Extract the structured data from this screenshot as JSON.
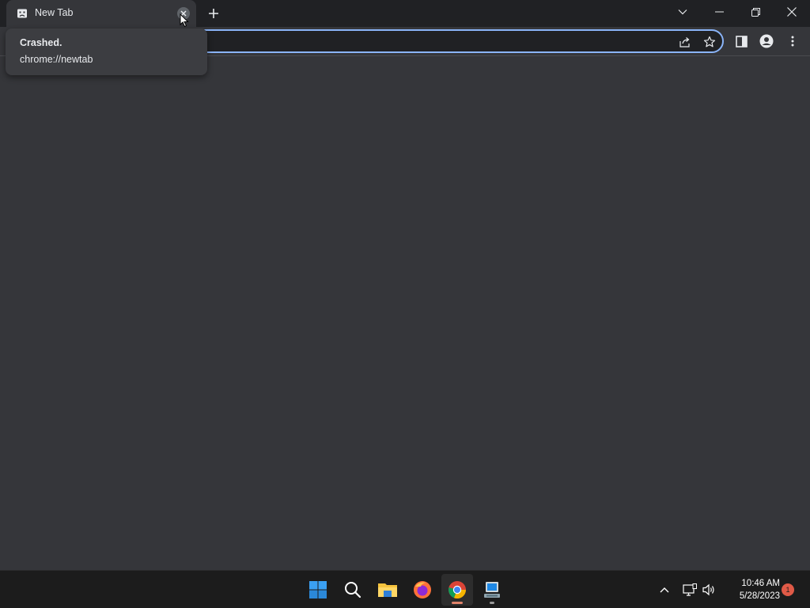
{
  "browser": {
    "tab": {
      "title": "New Tab",
      "favicon": "sad-tab-icon"
    },
    "hover_card": {
      "title": "Crashed.",
      "url": "chrome://newtab"
    },
    "window_controls": [
      "tab-search-icon",
      "minimize-icon",
      "restore-icon",
      "close-icon"
    ],
    "omnibox": {
      "value": "",
      "icons": [
        "share-icon",
        "bookmark-star-icon"
      ]
    },
    "toolbar_icons": [
      "side-panel-icon",
      "profile-icon",
      "menu-icon"
    ],
    "accent_color": "#8ab4f8",
    "background_color": "#35363a"
  },
  "taskbar": {
    "apps": [
      {
        "name": "start-icon",
        "active": false
      },
      {
        "name": "search-icon",
        "active": false
      },
      {
        "name": "file-explorer-icon",
        "active": false
      },
      {
        "name": "firefox-icon",
        "active": false
      },
      {
        "name": "chrome-icon",
        "active": true
      },
      {
        "name": "remote-desktop-icon",
        "active": false
      }
    ],
    "tray": [
      "show-hidden-icons-chevron",
      "network-icon",
      "volume-icon"
    ],
    "clock": {
      "time": "10:46 AM",
      "date": "5/28/2023"
    },
    "notification_count": "1"
  }
}
